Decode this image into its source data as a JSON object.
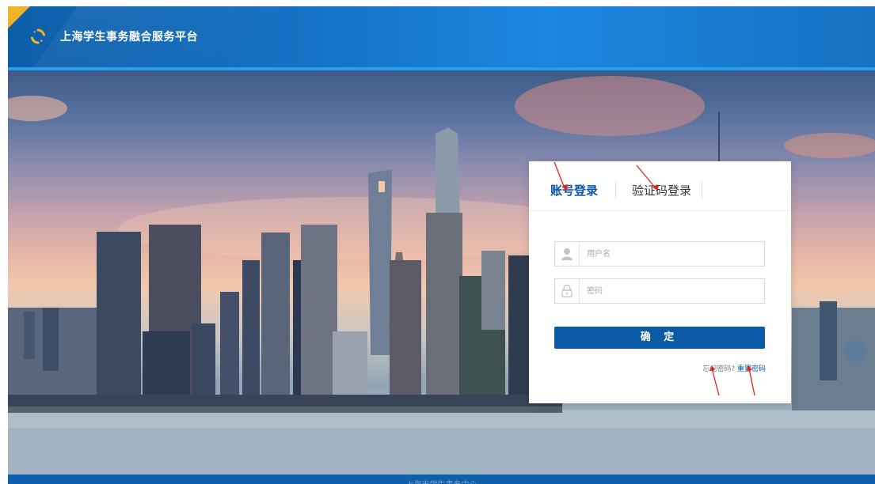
{
  "header": {
    "title": "上海学生事务融合服务平台",
    "logo_icon": "refresh-cycle-icon"
  },
  "colors": {
    "header_blue": "#1572c4",
    "accent_yellow": "#f0b32a",
    "button_blue": "#0b5aa8",
    "annotation_red": "#e8231b"
  },
  "login": {
    "tabs": [
      {
        "label": "账号登录",
        "active": true
      },
      {
        "label": "验证码登录",
        "active": false
      }
    ],
    "username": {
      "value": "",
      "placeholder": "用户名",
      "icon": "user-icon"
    },
    "password": {
      "value": "",
      "placeholder": "密码",
      "icon": "lock-icon"
    },
    "submit_label": "确 定",
    "forgot_text": "忘记密码?",
    "reset_label": "重置密码"
  },
  "footer": {
    "text": "上海市学生事务中心"
  }
}
